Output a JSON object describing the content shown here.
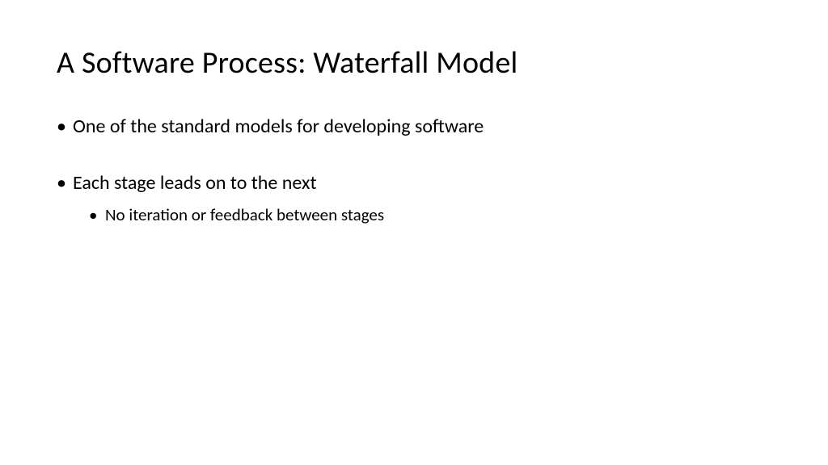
{
  "slide": {
    "title": "A Software Process: Waterfall Model",
    "bullets": [
      {
        "level": 1,
        "text": "One of the standard models for developing software"
      },
      {
        "level": 1,
        "text": "Each stage leads on to the next"
      },
      {
        "level": 2,
        "text": "No iteration or feedback between stages"
      }
    ]
  }
}
